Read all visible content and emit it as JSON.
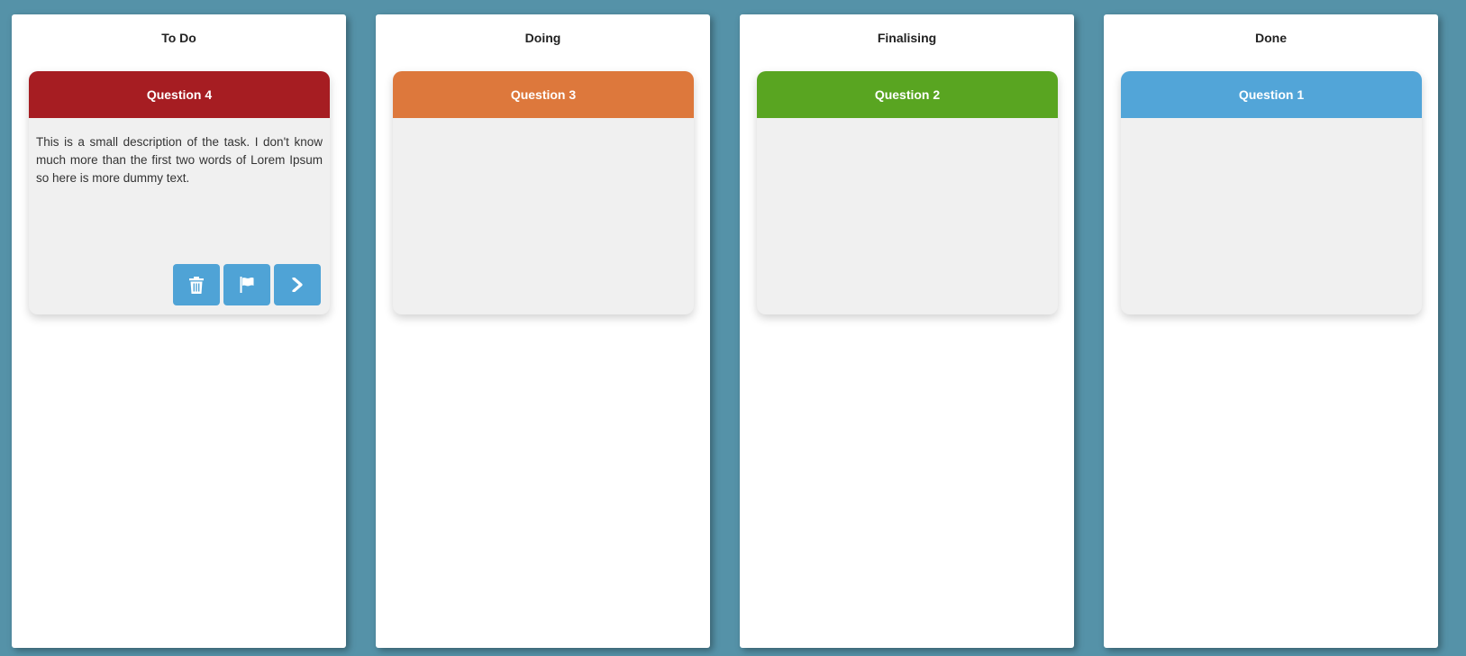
{
  "columns": [
    {
      "title": "To Do",
      "card": {
        "title": "Question 4",
        "color": "#a61d22",
        "description": "This is a small description of the task. I don't know much more than the first two words of Lorem Ipsum so here is more dummy text.",
        "actions": [
          {
            "icon": "trash-icon",
            "label": "delete"
          },
          {
            "icon": "flag-icon",
            "label": "flag"
          },
          {
            "icon": "chevron-right-icon",
            "label": "next"
          }
        ]
      }
    },
    {
      "title": "Doing",
      "card": {
        "title": "Question 3",
        "color": "#dd783c"
      }
    },
    {
      "title": "Finalising",
      "card": {
        "title": "Question 2",
        "color": "#59a521"
      }
    },
    {
      "title": "Done",
      "card": {
        "title": "Question 1",
        "color": "#52a5d8"
      }
    }
  ],
  "colors": {
    "background": "#5592a8",
    "button": "#4fa3d6",
    "card_body": "#f0f0f0"
  }
}
